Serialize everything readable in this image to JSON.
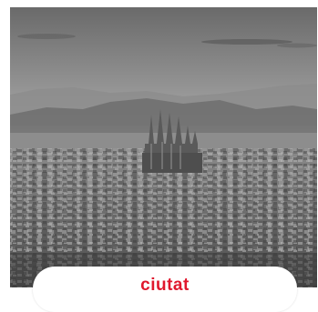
{
  "caption": {
    "text": "ciutat"
  },
  "colors": {
    "caption_text": "#e0182d",
    "card_background": "#ffffff"
  },
  "photo": {
    "subject": "city-skyline-icon"
  }
}
